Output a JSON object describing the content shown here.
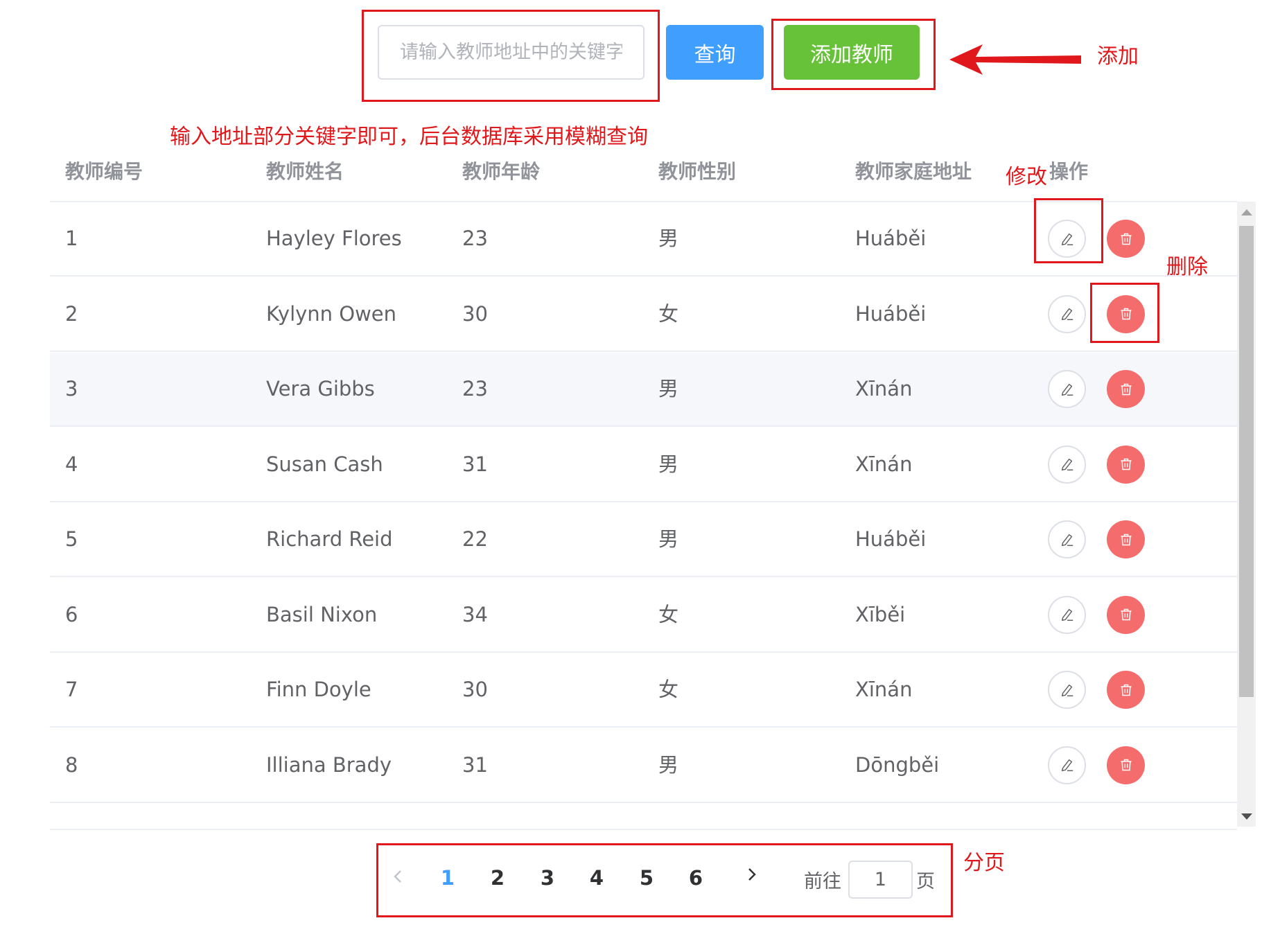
{
  "toolbar": {
    "search_placeholder": "请输入教师地址中的关键字",
    "search_label": "查询",
    "add_label": "添加教师"
  },
  "annotations": {
    "add": "添加",
    "search_hint": "输入地址部分关键字即可，后台数据库采用模糊查询",
    "edit": "修改",
    "delete": "删除",
    "pagination": "分页"
  },
  "table": {
    "headers": [
      "教师编号",
      "教师姓名",
      "教师年龄",
      "教师性别",
      "教师家庭地址",
      "操作"
    ],
    "rows": [
      {
        "id": "1",
        "name": "Hayley Flores",
        "age": "23",
        "gender": "男",
        "address": "Huáběi"
      },
      {
        "id": "2",
        "name": "Kylynn Owen",
        "age": "30",
        "gender": "女",
        "address": "Huáběi"
      },
      {
        "id": "3",
        "name": "Vera Gibbs",
        "age": "23",
        "gender": "男",
        "address": "Xīnán"
      },
      {
        "id": "4",
        "name": "Susan Cash",
        "age": "31",
        "gender": "男",
        "address": "Xīnán"
      },
      {
        "id": "5",
        "name": "Richard Reid",
        "age": "22",
        "gender": "男",
        "address": "Huáběi"
      },
      {
        "id": "6",
        "name": "Basil Nixon",
        "age": "34",
        "gender": "女",
        "address": "Xīběi"
      },
      {
        "id": "7",
        "name": "Finn Doyle",
        "age": "30",
        "gender": "女",
        "address": "Xīnán"
      },
      {
        "id": "8",
        "name": "Illiana Brady",
        "age": "31",
        "gender": "男",
        "address": "Dōngběi"
      }
    ],
    "icons": {
      "edit": "edit-pencil-icon",
      "delete": "trash-icon"
    }
  },
  "pagination": {
    "pages": [
      "1",
      "2",
      "3",
      "4",
      "5",
      "6"
    ],
    "current_page": 1,
    "goto_label": "前往",
    "goto_value": "1",
    "page_suffix": "页"
  },
  "colors": {
    "primary": "#409eff",
    "success": "#67c23a",
    "danger": "#f56c6c",
    "annotation": "#e0181b"
  }
}
